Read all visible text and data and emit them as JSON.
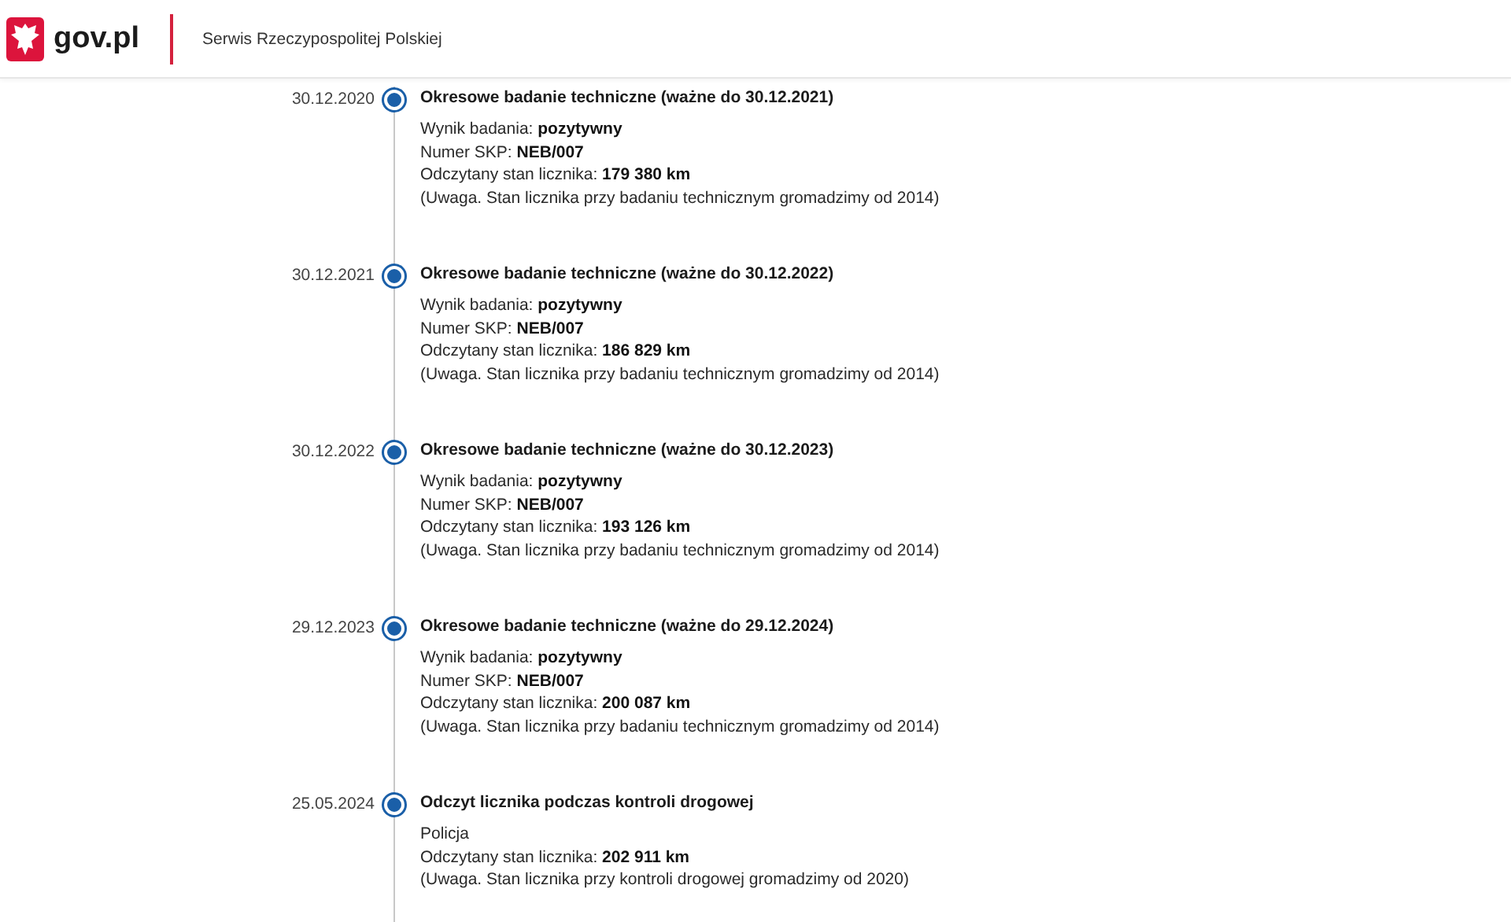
{
  "header": {
    "logo_text": "gov.pl",
    "service_name": "Serwis Rzeczypospolitej Polskiej"
  },
  "timeline": [
    {
      "date": "30.12.2020",
      "title": "Okresowe badanie techniczne (ważne do 30.12.2021)",
      "lines": [
        "Wynik badania: **pozytywny**",
        "Numer SKP: **NEB/007**",
        "Odczytany stan licznika: **179 380 km**",
        "(Uwaga. Stan licznika przy badaniu technicznym gromadzimy od 2014)"
      ]
    },
    {
      "date": "30.12.2021",
      "title": "Okresowe badanie techniczne (ważne do 30.12.2022)",
      "lines": [
        "Wynik badania: **pozytywny**",
        "Numer SKP: **NEB/007**",
        "Odczytany stan licznika: **186 829 km**",
        "(Uwaga. Stan licznika przy badaniu technicznym gromadzimy od 2014)"
      ]
    },
    {
      "date": "30.12.2022",
      "title": "Okresowe badanie techniczne (ważne do 30.12.2023)",
      "lines": [
        "Wynik badania: **pozytywny**",
        "Numer SKP: **NEB/007**",
        "Odczytany stan licznika: **193 126 km**",
        "(Uwaga. Stan licznika przy badaniu technicznym gromadzimy od 2014)"
      ]
    },
    {
      "date": "29.12.2023",
      "title": "Okresowe badanie techniczne (ważne do 29.12.2024)",
      "lines": [
        "Wynik badania: **pozytywny**",
        "Numer SKP: **NEB/007**",
        "Odczytany stan licznika: **200 087 km**",
        "(Uwaga. Stan licznika przy badaniu technicznym gromadzimy od 2014)"
      ]
    },
    {
      "date": "25.05.2024",
      "title": "Odczyt licznika podczas kontroli drogowej",
      "lines": [
        "Policja",
        "Odczytany stan licznika: **202 911 km**",
        "(Uwaga. Stan licznika przy kontroli drogowej gromadzimy od 2020)"
      ]
    }
  ]
}
